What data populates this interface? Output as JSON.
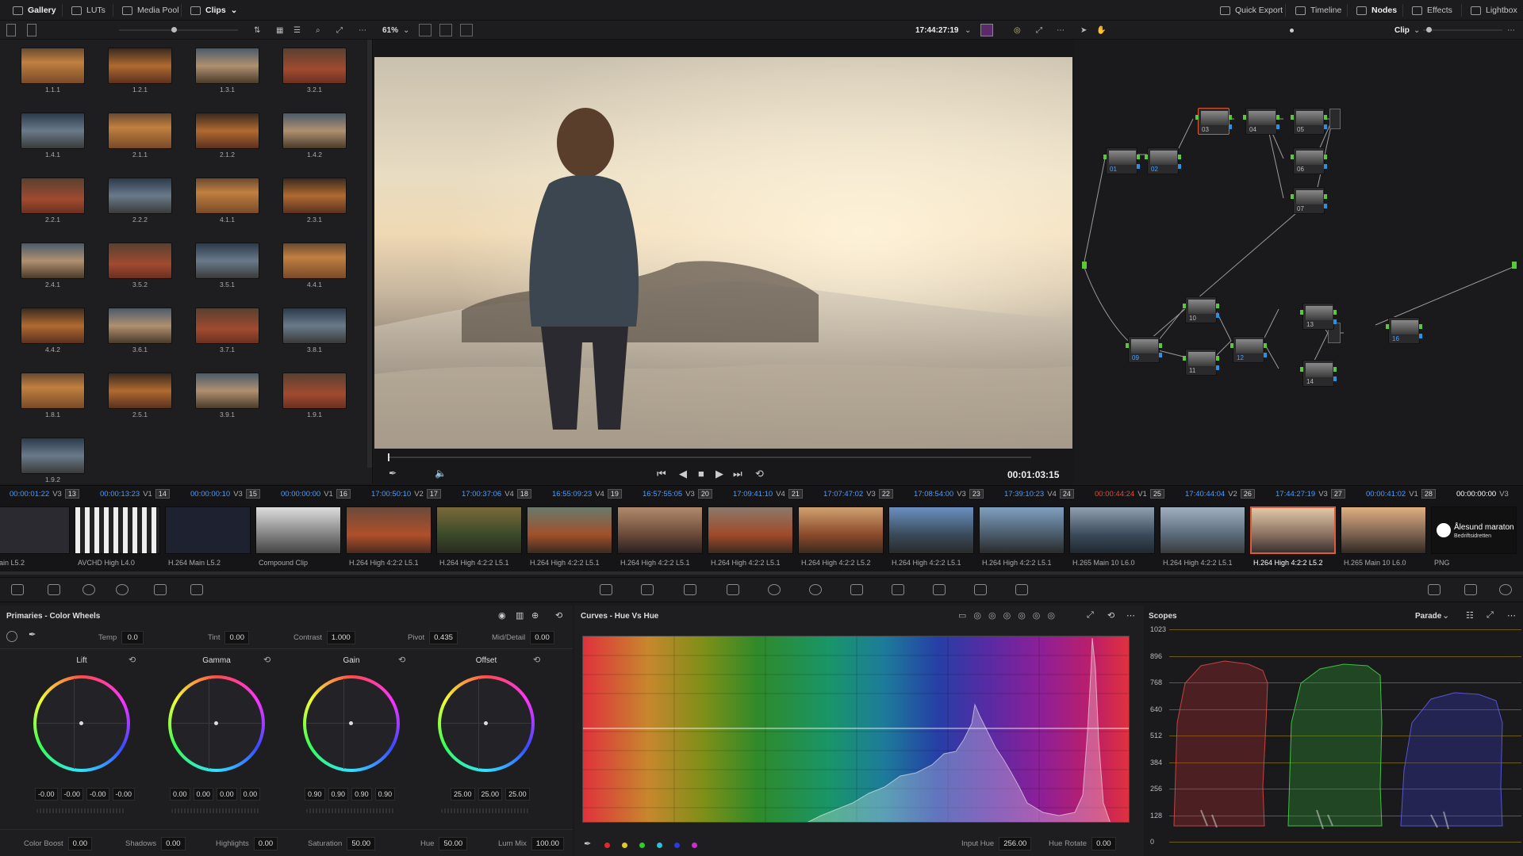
{
  "topbar": {
    "left": [
      "Gallery",
      "LUTs",
      "Media Pool",
      "Clips"
    ],
    "right": [
      "Quick Export",
      "Timeline",
      "Nodes",
      "Effects",
      "Lightbox"
    ]
  },
  "viewer": {
    "zoom": "61%",
    "timecode_top": "17:44:27:19",
    "timecode_bottom": "00:01:03:15",
    "clip_mode": "Clip"
  },
  "gallery": {
    "stills": [
      "1.1.1",
      "1.2.1",
      "1.3.1",
      "3.2.1",
      "1.4.1",
      "2.1.1",
      "2.1.2",
      "1.4.2",
      "2.2.1",
      "2.2.2",
      "4.1.1",
      "2.3.1",
      "2.4.1",
      "3.5.2",
      "3.5.1",
      "4.4.1",
      "4.4.2",
      "3.6.1",
      "3.7.1",
      "3.8.1",
      "1.8.1",
      "2.5.1",
      "3.9.1",
      "1.9.1",
      "1.9.2"
    ]
  },
  "nodes": [
    {
      "num": "01",
      "blue": true
    },
    {
      "num": "02",
      "blue": true
    },
    {
      "num": "03",
      "blue": false
    },
    {
      "num": "04",
      "blue": false
    },
    {
      "num": "05",
      "blue": false
    },
    {
      "num": "06",
      "blue": false
    },
    {
      "num": "07",
      "blue": false
    },
    {
      "num": "09",
      "blue": true
    },
    {
      "num": "10",
      "blue": false
    },
    {
      "num": "11",
      "blue": false
    },
    {
      "num": "12",
      "blue": true
    },
    {
      "num": "13",
      "blue": false
    },
    {
      "num": "14",
      "blue": false
    },
    {
      "num": "16",
      "blue": true
    }
  ],
  "timeline": {
    "header": [
      {
        "tc": "00:00:01:22",
        "track": "V3",
        "num": "13"
      },
      {
        "tc": "00:00:13:23",
        "track": "V1",
        "num": "14"
      },
      {
        "tc": "00:00:00:10",
        "track": "V3",
        "num": "15"
      },
      {
        "tc": "00:00:00:00",
        "track": "V1",
        "num": "16"
      },
      {
        "tc": "17:00:50:10",
        "track": "V2",
        "num": "17"
      },
      {
        "tc": "17:00:37:06",
        "track": "V4",
        "num": "18"
      },
      {
        "tc": "16:55:09:23",
        "track": "V4",
        "num": "19"
      },
      {
        "tc": "16:57:55:05",
        "track": "V3",
        "num": "20"
      },
      {
        "tc": "17:09:41:10",
        "track": "V4",
        "num": "21"
      },
      {
        "tc": "17:07:47:02",
        "track": "V3",
        "num": "22"
      },
      {
        "tc": "17:08:54:00",
        "track": "V3",
        "num": "23"
      },
      {
        "tc": "17:39:10:23",
        "track": "V4",
        "num": "24"
      },
      {
        "tc": "00:00:44:24",
        "track": "V1",
        "num": "25"
      },
      {
        "tc": "17:40:44:04",
        "track": "V2",
        "num": "26"
      },
      {
        "tc": "17:44:27:19",
        "track": "V3",
        "num": "27"
      },
      {
        "tc": "00:00:41:02",
        "track": "V1",
        "num": "28"
      },
      {
        "tc": "00:00:00:00",
        "track": "V3",
        "num": ""
      }
    ],
    "clips": [
      "4 Main L5.2",
      "AVCHD High L4.0",
      "H.264 Main L5.2",
      "Compound Clip",
      "H.264 High 4:2:2 L5.1",
      "H.264 High 4:2:2 L5.1",
      "H.264 High 4:2:2 L5.1",
      "H.264 High 4:2:2 L5.1",
      "H.264 High 4:2:2 L5.1",
      "H.264 High 4:2:2 L5.2",
      "H.264 High 4:2:2 L5.1",
      "H.264 High 4:2:2 L5.1",
      "H.265 Main 10 L6.0",
      "H.264 High 4:2:2 L5.1",
      "H.264 High 4:2:2 L5.2",
      "H.265 Main 10 L6.0",
      "PNG"
    ],
    "logo_title": "Ålesund maraton",
    "logo_sub": "Bedriftsidretten"
  },
  "primaries": {
    "title": "Primaries - Color Wheels",
    "temp_label": "Temp",
    "temp": "0.0",
    "tint_label": "Tint",
    "tint": "0.00",
    "contrast_label": "Contrast",
    "contrast": "1.000",
    "pivot_label": "Pivot",
    "pivot": "0.435",
    "middetail_label": "Mid/Detail",
    "middetail": "0.00",
    "wheels": [
      {
        "name": "Lift",
        "vals": [
          "-0.00",
          "-0.00",
          "-0.00",
          "-0.00"
        ]
      },
      {
        "name": "Gamma",
        "vals": [
          "0.00",
          "0.00",
          "0.00",
          "0.00"
        ]
      },
      {
        "name": "Gain",
        "vals": [
          "0.90",
          "0.90",
          "0.90",
          "0.90"
        ]
      },
      {
        "name": "Offset",
        "vals": [
          "25.00",
          "25.00",
          "25.00"
        ]
      }
    ],
    "colorboost_label": "Color Boost",
    "colorboost": "0.00",
    "shadows_label": "Shadows",
    "shadows": "0.00",
    "highlights_label": "Highlights",
    "highlights": "0.00",
    "saturation_label": "Saturation",
    "saturation": "50.00",
    "hue_label": "Hue",
    "hue": "50.00",
    "lummix_label": "Lum Mix",
    "lummix": "100.00"
  },
  "curves": {
    "title": "Curves - Hue Vs Hue",
    "input_hue_label": "Input Hue",
    "input_hue": "256.00",
    "hue_rotate_label": "Hue Rotate",
    "hue_rotate": "0.00",
    "dot_colors": [
      "#e02a2a",
      "#e0c82a",
      "#2ad02a",
      "#2ac0e0",
      "#2a3ae0",
      "#d02ad0"
    ]
  },
  "scopes": {
    "title": "Scopes",
    "mode": "Parade",
    "scale": [
      "1023",
      "896",
      "768",
      "640",
      "512",
      "384",
      "256",
      "128",
      "0"
    ]
  }
}
